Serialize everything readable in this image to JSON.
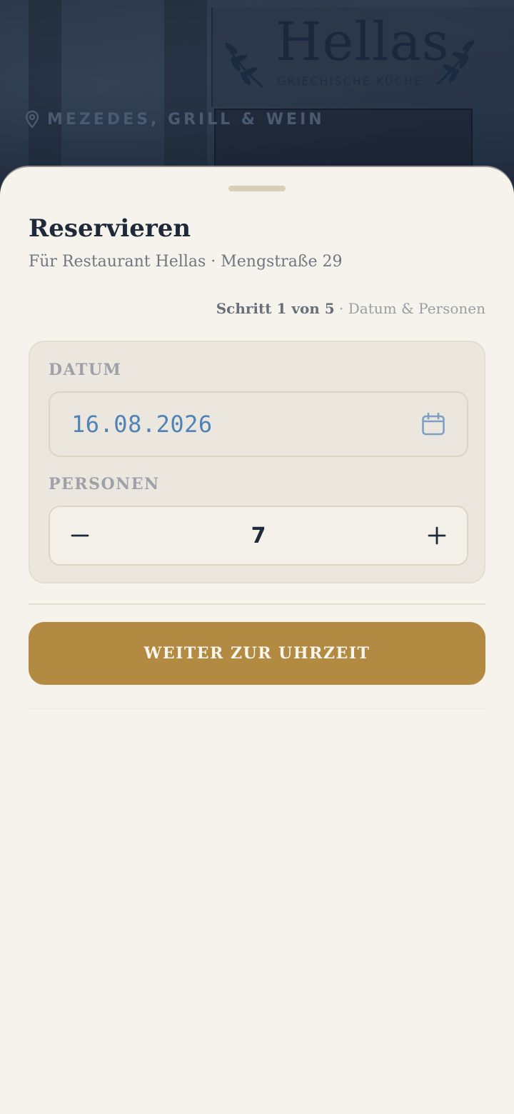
{
  "hero": {
    "brand": "Hellas",
    "brand_sub": "GRIECHISCHE KÜCHE",
    "tagline": "MEZEDES, GRILL & WEIN",
    "tagline_icon": "location-pin-icon"
  },
  "sheet": {
    "title": "Reservieren",
    "subtitle": "Für Restaurant Hellas · Mengstraße 29",
    "step_current": "Schritt 1 von 5",
    "step_detail": " · Datum & Personen"
  },
  "form": {
    "date_label": "DATUM",
    "date_value": "16.08.2026",
    "date_icon": "calendar-icon",
    "persons_label": "PERSONEN",
    "persons_value": "7",
    "minus_icon": "minus-icon",
    "plus_icon": "plus-icon"
  },
  "cta": {
    "label": "WEITER ZUR UHRZEIT"
  },
  "colors": {
    "accent": "#b38a41",
    "date_text": "#4f83b6",
    "title": "#1e2a3a",
    "sheet_bg": "#f6f3ec",
    "hero_bg": "#233044"
  }
}
